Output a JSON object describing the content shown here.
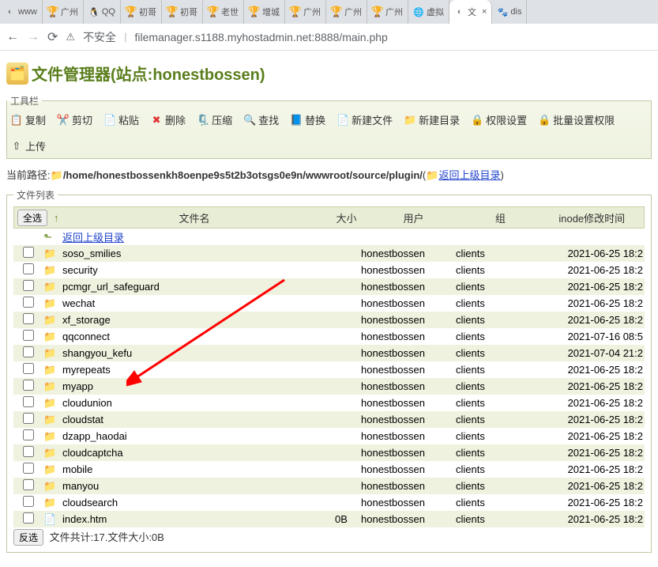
{
  "tabs": [
    {
      "icon": "globe",
      "label": "www"
    },
    {
      "icon": "cup",
      "label": "广州"
    },
    {
      "icon": "qq",
      "label": "QQ"
    },
    {
      "icon": "cup",
      "label": "初哥"
    },
    {
      "icon": "cup",
      "label": "初哥"
    },
    {
      "icon": "cup",
      "label": "老世"
    },
    {
      "icon": "cup",
      "label": "增城"
    },
    {
      "icon": "cup",
      "label": "广州"
    },
    {
      "icon": "cup",
      "label": "广州"
    },
    {
      "icon": "cup",
      "label": "广州"
    },
    {
      "icon": "blue",
      "label": "虚拟"
    },
    {
      "icon": "globe",
      "label": "文",
      "active": true,
      "close": "×"
    },
    {
      "icon": "paw",
      "label": "dis"
    }
  ],
  "addr": {
    "insecure": "不安全",
    "url": "filemanager.s1188.myhostadmin.net:8888/main.php"
  },
  "title": "文件管理器(站点:honestbossen)",
  "toolbar_legend": "工具栏",
  "toolbar": {
    "copy": "复制",
    "cut": "剪切",
    "paste": "粘贴",
    "delete": "删除",
    "compress": "压缩",
    "find": "查找",
    "replace": "替换",
    "newfile": "新建文件",
    "newdir": "新建目录",
    "perm": "权限设置",
    "bperm": "批量设置权限",
    "upload": "上传"
  },
  "path": {
    "prefix": "当前路径:",
    "value": "/home/honestbossenkh8oenpe9s5t2b3otsgs0e9n/wwwroot/source/plugin/",
    "back": "返回上级目录"
  },
  "list_legend": "文件列表",
  "header": {
    "selectAll": "全选",
    "name": "文件名",
    "size": "大小",
    "user": "用户",
    "group": "组",
    "mtime": "inode修改时间"
  },
  "back_link": "返回上级目录",
  "rows": [
    {
      "type": "dir",
      "name": "soso_smilies",
      "size": "",
      "user": "honestbossen",
      "group": "clients",
      "time": "2021-06-25 18:2"
    },
    {
      "type": "dir",
      "name": "security",
      "size": "",
      "user": "honestbossen",
      "group": "clients",
      "time": "2021-06-25 18:2"
    },
    {
      "type": "dir",
      "name": "pcmgr_url_safeguard",
      "size": "",
      "user": "honestbossen",
      "group": "clients",
      "time": "2021-06-25 18:2"
    },
    {
      "type": "dir",
      "name": "wechat",
      "size": "",
      "user": "honestbossen",
      "group": "clients",
      "time": "2021-06-25 18:2"
    },
    {
      "type": "dir",
      "name": "xf_storage",
      "size": "",
      "user": "honestbossen",
      "group": "clients",
      "time": "2021-06-25 18:2"
    },
    {
      "type": "dir",
      "name": "qqconnect",
      "size": "",
      "user": "honestbossen",
      "group": "clients",
      "time": "2021-07-16 08:5"
    },
    {
      "type": "dir",
      "name": "shangyou_kefu",
      "size": "",
      "user": "honestbossen",
      "group": "clients",
      "time": "2021-07-04 21:2"
    },
    {
      "type": "dir",
      "name": "myrepeats",
      "size": "",
      "user": "honestbossen",
      "group": "clients",
      "time": "2021-06-25 18:2"
    },
    {
      "type": "dir",
      "name": "myapp",
      "size": "",
      "user": "honestbossen",
      "group": "clients",
      "time": "2021-06-25 18:2"
    },
    {
      "type": "dir",
      "name": "cloudunion",
      "size": "",
      "user": "honestbossen",
      "group": "clients",
      "time": "2021-06-25 18:2"
    },
    {
      "type": "dir",
      "name": "cloudstat",
      "size": "",
      "user": "honestbossen",
      "group": "clients",
      "time": "2021-06-25 18:2"
    },
    {
      "type": "dir",
      "name": "dzapp_haodai",
      "size": "",
      "user": "honestbossen",
      "group": "clients",
      "time": "2021-06-25 18:2"
    },
    {
      "type": "dir",
      "name": "cloudcaptcha",
      "size": "",
      "user": "honestbossen",
      "group": "clients",
      "time": "2021-06-25 18:2"
    },
    {
      "type": "dir",
      "name": "mobile",
      "size": "",
      "user": "honestbossen",
      "group": "clients",
      "time": "2021-06-25 18:2"
    },
    {
      "type": "dir",
      "name": "manyou",
      "size": "",
      "user": "honestbossen",
      "group": "clients",
      "time": "2021-06-25 18:2"
    },
    {
      "type": "dir",
      "name": "cloudsearch",
      "size": "",
      "user": "honestbossen",
      "group": "clients",
      "time": "2021-06-25 18:2"
    },
    {
      "type": "file",
      "name": "index.htm",
      "size": "0B",
      "user": "honestbossen",
      "group": "clients",
      "time": "2021-06-25 18:2"
    }
  ],
  "footer": {
    "invert": "反选",
    "summary": "文件共计:17.文件大小:0B"
  }
}
